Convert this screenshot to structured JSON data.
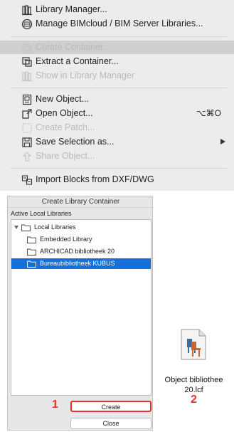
{
  "menu": {
    "items": [
      {
        "label": "Library Manager...",
        "icon": "library-manager-icon",
        "enabled": true
      },
      {
        "label": "Manage BIMcloud / BIM Server Libraries...",
        "icon": "bimcloud-icon",
        "enabled": true
      },
      {
        "label": "Create Container...",
        "icon": "create-container-icon",
        "enabled": false,
        "highlighted": true
      },
      {
        "label": "Extract a Container...",
        "icon": "extract-container-icon",
        "enabled": true
      },
      {
        "label": "Show in Library Manager",
        "icon": "library-manager-icon",
        "enabled": false
      },
      {
        "label": "New Object...",
        "icon": "new-object-icon",
        "enabled": true
      },
      {
        "label": "Open Object...",
        "icon": "open-object-icon",
        "enabled": true,
        "shortcut": "⌥⌘O"
      },
      {
        "label": "Create Patch...",
        "icon": "create-patch-icon",
        "enabled": false
      },
      {
        "label": "Save Selection as...",
        "icon": "save-icon",
        "enabled": true,
        "submenu": true
      },
      {
        "label": "Share Object...",
        "icon": "share-icon",
        "enabled": false
      },
      {
        "label": "Import Blocks from DXF/DWG",
        "icon": "import-blocks-icon",
        "enabled": true
      }
    ]
  },
  "dialog": {
    "title": "Create Library Container",
    "section_label": "Active Local Libraries",
    "tree": [
      {
        "label": "Local Libraries",
        "level": 0,
        "expanded": true
      },
      {
        "label": "Embedded Library",
        "level": 1
      },
      {
        "label": "ARCHICAD bibliotheek 20",
        "level": 1
      },
      {
        "label": "Bureaubibliotheek KUBUS",
        "level": 1,
        "selected": true
      }
    ],
    "create_button": "Create",
    "close_button": "Close",
    "marker_1": "1"
  },
  "file": {
    "name_line1": "Object bibliothee",
    "name_line2": "20.lcf",
    "marker_2": "2"
  },
  "colors": {
    "menu_background": "#ececec",
    "highlight": "#cfcfcf",
    "selection": "#1470d8",
    "annotation": "#e0332a"
  }
}
